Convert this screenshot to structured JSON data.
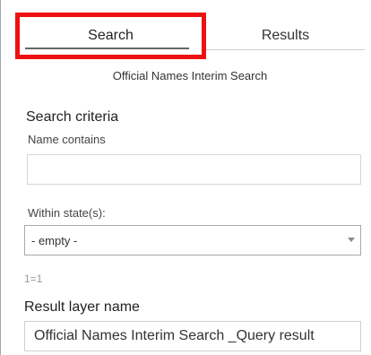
{
  "tabs": {
    "search_label": "Search",
    "results_label": "Results"
  },
  "subtitle": "Official Names Interim Search",
  "criteria": {
    "title": "Search criteria",
    "name_label": "Name contains",
    "name_value": "",
    "state_label": "Within state(s):",
    "state_selected": "- empty -",
    "expression": "1=1"
  },
  "result": {
    "title": "Result layer name",
    "value": "Official Names Interim Search _Query result"
  },
  "colors": {
    "highlight_border": "#ee1111",
    "panel_border": "#9aa7b3"
  }
}
